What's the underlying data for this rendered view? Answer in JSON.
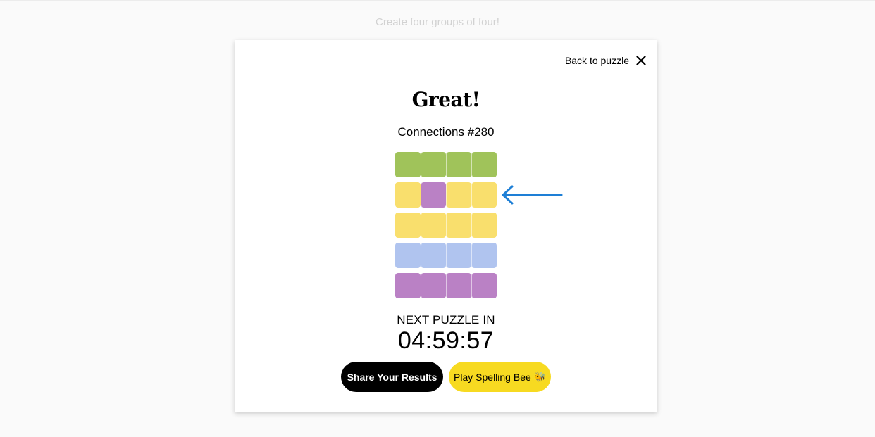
{
  "page": {
    "subtitle": "Create four groups of four!"
  },
  "modal": {
    "back_label": "Back to puzzle",
    "close_icon": "close-icon",
    "headline": "Great!",
    "puzzle_number": "Connections #280",
    "result_grid": [
      [
        "green",
        "green",
        "green",
        "green"
      ],
      [
        "yellow",
        "purple",
        "yellow",
        "yellow"
      ],
      [
        "yellow",
        "yellow",
        "yellow",
        "yellow"
      ],
      [
        "blue",
        "blue",
        "blue",
        "blue"
      ],
      [
        "purple",
        "purple",
        "purple",
        "purple"
      ]
    ],
    "annotation_icon": "arrow-left-icon",
    "next_label": "NEXT PUZZLE IN",
    "countdown": "04:59:57",
    "share_button": "Share Your Results",
    "bee_button": "Play Spelling Bee",
    "bee_icon": "bee-icon",
    "bee_glyph": "🐝"
  },
  "colors": {
    "green": "#a0c35a",
    "yellow": "#f9df6d",
    "blue": "#b0c4ef",
    "purple": "#ba81c5",
    "bee_yellow": "#f7da21",
    "annotation_blue": "#1e7fd6"
  }
}
